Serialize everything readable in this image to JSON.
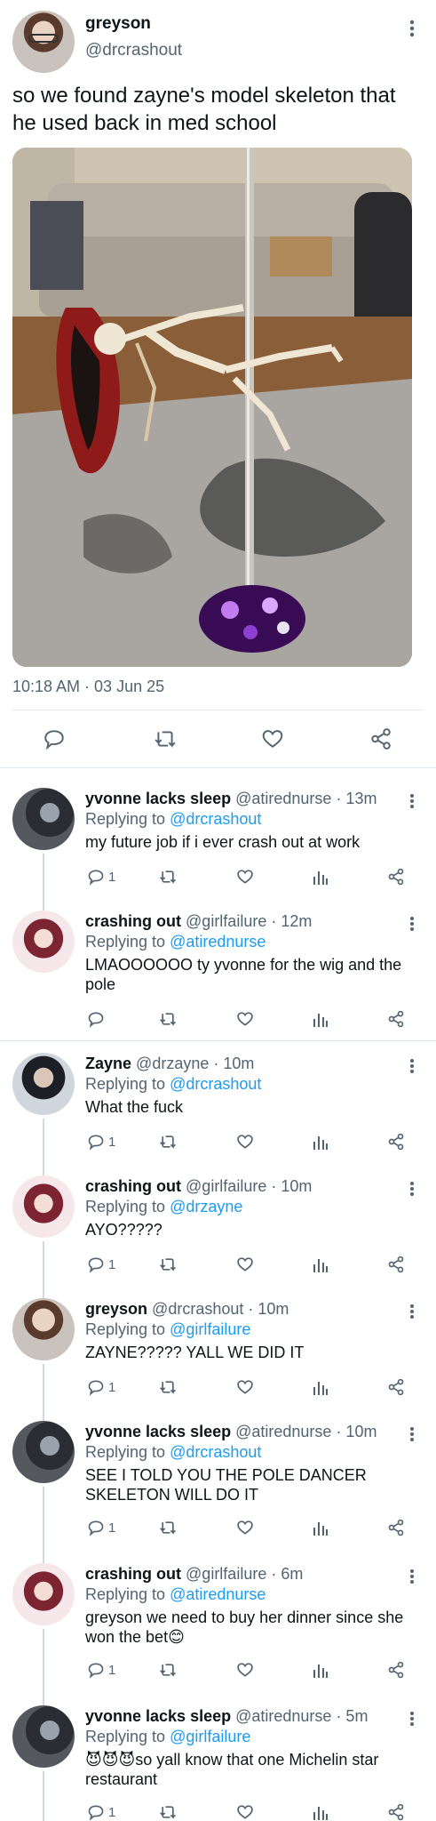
{
  "main_tweet": {
    "author_name": "greyson",
    "author_handle": "@drcrashout",
    "more_glyph": "⋮",
    "text": "so we found zayne's model skeleton that he used back in med school",
    "timestamp": "10:18 AM · 03 Jun 25"
  },
  "replies": [
    {
      "name": "yvonne lacks sleep",
      "meta": "@atirednurse · 13m",
      "replying_prefix": "Replying to ",
      "replying_to": "@drcrashout",
      "text": "my future job if i ever crash out at work",
      "reply_count": "1"
    },
    {
      "name": "crashing out",
      "meta": "@girlfailure · 12m",
      "replying_prefix": "Replying to ",
      "replying_to": "@atirednurse",
      "text": "LMAOOOOOO ty yvonne for the wig and the pole",
      "reply_count": ""
    },
    {
      "name": "Zayne",
      "meta": "@drzayne · 10m",
      "replying_prefix": "Replying to ",
      "replying_to": "@drcrashout",
      "text": "What the fuck",
      "reply_count": "1"
    },
    {
      "name": "crashing out",
      "meta": "@girlfailure · 10m",
      "replying_prefix": "Replying to ",
      "replying_to": "@drzayne",
      "text": "AYO?????",
      "reply_count": "1"
    },
    {
      "name": "greyson",
      "meta": "@drcrashout · 10m",
      "replying_prefix": "Replying to ",
      "replying_to": "@girlfailure",
      "text": "ZAYNE????? YALL WE DID IT",
      "reply_count": "1"
    },
    {
      "name": "yvonne lacks sleep",
      "meta": "@atirednurse · 10m",
      "replying_prefix": "Replying to ",
      "replying_to": "@drcrashout",
      "text": "SEE I TOLD YOU THE POLE DANCER SKELETON WILL DO IT",
      "reply_count": "1"
    },
    {
      "name": "crashing out",
      "meta": "@girlfailure · 6m",
      "replying_prefix": "Replying to ",
      "replying_to": "@atirednurse",
      "text": "greyson we need to buy her dinner since she won the bet😊",
      "reply_count": "1"
    },
    {
      "name": "yvonne lacks sleep",
      "meta": "@atirednurse · 5m",
      "replying_prefix": "Replying to ",
      "replying_to": "@girlfailure",
      "text": "😈😈😈so yall know that one Michelin star restaurant",
      "reply_count": "1"
    }
  ],
  "icons": {
    "reply": "reply-icon",
    "retweet": "retweet-icon",
    "like": "heart-icon",
    "views": "analytics-icon",
    "share": "share-icon",
    "more": "more-icon"
  },
  "colors": {
    "link": "#1d9bf0",
    "secondary_text": "#536471",
    "primary_text": "#0f1419"
  }
}
